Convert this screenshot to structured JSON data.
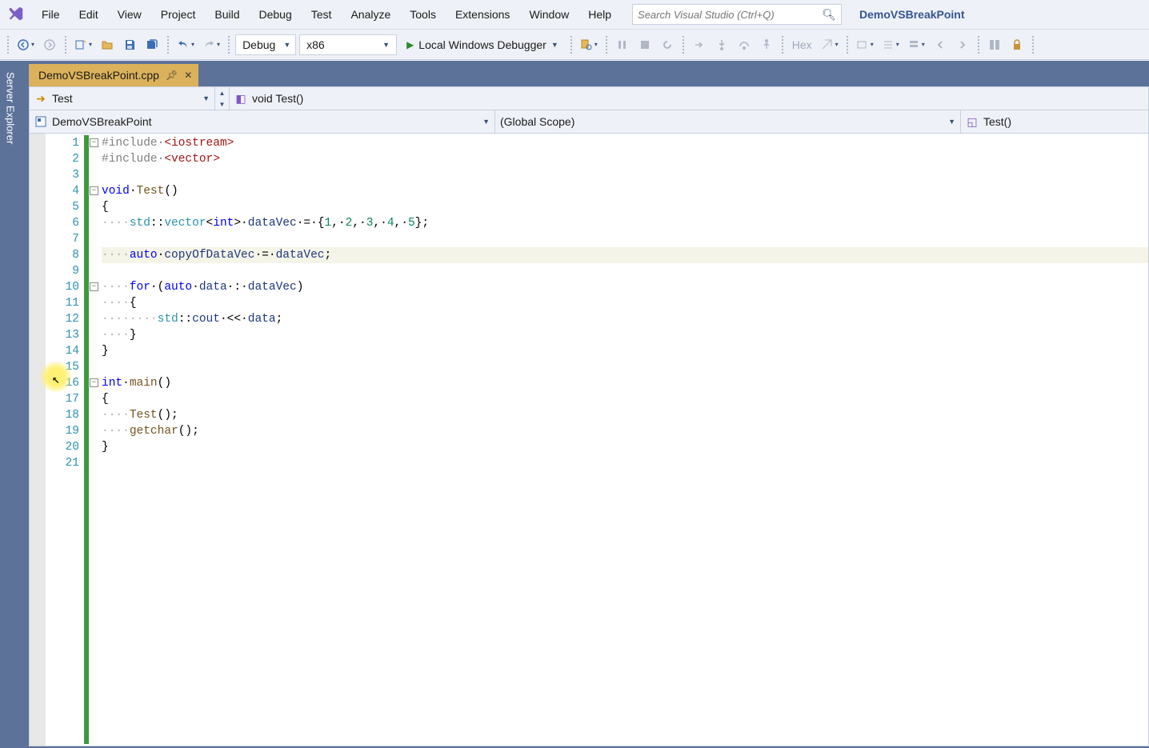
{
  "menu": {
    "items": [
      "File",
      "Edit",
      "View",
      "Project",
      "Build",
      "Debug",
      "Test",
      "Analyze",
      "Tools",
      "Extensions",
      "Window",
      "Help"
    ]
  },
  "search": {
    "placeholder": "Search Visual Studio (Ctrl+Q)"
  },
  "solution": {
    "name": "DemoVSBreakPoint"
  },
  "toolbar": {
    "config": "Debug",
    "platform": "x86",
    "debugger": "Local Windows Debugger",
    "hex": "Hex"
  },
  "siderail": {
    "label": "Server Explorer"
  },
  "tab": {
    "filename": "DemoVSBreakPoint.cpp"
  },
  "nav": {
    "row1_class": "Test",
    "row1_func": "void Test()",
    "row2_project": "DemoVSBreakPoint",
    "row2_scope": "(Global Scope)",
    "row2_member": "Test()"
  },
  "code": {
    "lines": [
      {
        "n": 1,
        "fold": "-",
        "seg": [
          [
            "pre",
            "#include·"
          ],
          [
            "str",
            "<iostream>"
          ]
        ]
      },
      {
        "n": 2,
        "seg": [
          [
            "pre",
            "#include·"
          ],
          [
            "str",
            "<vector>"
          ]
        ]
      },
      {
        "n": 3,
        "seg": [
          [
            "",
            ""
          ]
        ]
      },
      {
        "n": 4,
        "fold": "-",
        "seg": [
          [
            "kw",
            "void"
          ],
          [
            "",
            ""
          ],
          [
            "",
            "·"
          ],
          [
            "func",
            "Test"
          ],
          [
            "",
            "()"
          ]
        ]
      },
      {
        "n": 5,
        "seg": [
          [
            "",
            "{"
          ]
        ]
      },
      {
        "n": 6,
        "seg": [
          [
            "dot",
            "····"
          ],
          [
            "type",
            "std"
          ],
          [
            "",
            "::"
          ],
          [
            "type",
            "vector"
          ],
          [
            "",
            "<"
          ],
          [
            "kw",
            "int"
          ],
          [
            "",
            ">·"
          ],
          [
            "var",
            "dataVec"
          ],
          [
            "",
            "·=·{"
          ],
          [
            "num",
            "1"
          ],
          [
            "",
            ",·"
          ],
          [
            "num",
            "2"
          ],
          [
            "",
            ",·"
          ],
          [
            "num",
            "3"
          ],
          [
            "",
            ",·"
          ],
          [
            "num",
            "4"
          ],
          [
            "",
            ",·"
          ],
          [
            "num",
            "5"
          ],
          [
            "",
            "};"
          ]
        ]
      },
      {
        "n": 7,
        "seg": [
          [
            "",
            ""
          ]
        ]
      },
      {
        "n": 8,
        "hl": true,
        "seg": [
          [
            "dot",
            "····"
          ],
          [
            "kw",
            "auto"
          ],
          [
            "",
            "·"
          ],
          [
            "var",
            "copyOfDataVec"
          ],
          [
            "",
            "·=·"
          ],
          [
            "var",
            "dataVec"
          ],
          [
            "",
            ";"
          ]
        ]
      },
      {
        "n": 9,
        "seg": [
          [
            "",
            ""
          ]
        ]
      },
      {
        "n": 10,
        "fold": "-",
        "seg": [
          [
            "dot",
            "····"
          ],
          [
            "kw",
            "for"
          ],
          [
            "",
            "·("
          ],
          [
            "kw",
            "auto"
          ],
          [
            "",
            "·"
          ],
          [
            "var",
            "data"
          ],
          [
            "",
            "·:·"
          ],
          [
            "var",
            "dataVec"
          ],
          [
            "",
            ")"
          ]
        ]
      },
      {
        "n": 11,
        "seg": [
          [
            "dot",
            "····"
          ],
          [
            "",
            "{"
          ]
        ]
      },
      {
        "n": 12,
        "seg": [
          [
            "dot",
            "········"
          ],
          [
            "type",
            "std"
          ],
          [
            "",
            "::"
          ],
          [
            "var",
            "cout"
          ],
          [
            "",
            "·<<·"
          ],
          [
            "var",
            "data"
          ],
          [
            "",
            ";"
          ]
        ]
      },
      {
        "n": 13,
        "seg": [
          [
            "dot",
            "····"
          ],
          [
            "",
            "}"
          ]
        ]
      },
      {
        "n": 14,
        "seg": [
          [
            "",
            "}"
          ]
        ]
      },
      {
        "n": 15,
        "seg": [
          [
            "",
            ""
          ]
        ]
      },
      {
        "n": 16,
        "fold": "-",
        "seg": [
          [
            "kw",
            "int"
          ],
          [
            "",
            "·"
          ],
          [
            "func",
            "main"
          ],
          [
            "",
            "()"
          ]
        ]
      },
      {
        "n": 17,
        "seg": [
          [
            "",
            "{"
          ]
        ]
      },
      {
        "n": 18,
        "seg": [
          [
            "dot",
            "····"
          ],
          [
            "func",
            "Test"
          ],
          [
            "",
            "();"
          ]
        ]
      },
      {
        "n": 19,
        "seg": [
          [
            "dot",
            "····"
          ],
          [
            "func",
            "getchar"
          ],
          [
            "",
            "();"
          ]
        ]
      },
      {
        "n": 20,
        "seg": [
          [
            "",
            "}"
          ]
        ]
      },
      {
        "n": 21,
        "seg": [
          [
            "",
            ""
          ]
        ]
      }
    ]
  }
}
